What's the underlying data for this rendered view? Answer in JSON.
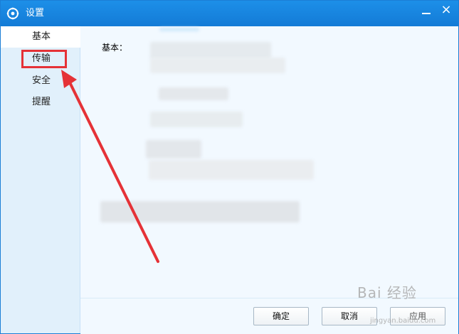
{
  "window": {
    "title": "设置",
    "icon": "gear-icon",
    "minimize_icon": "minimize-icon",
    "close_icon": "close-icon",
    "close_glyph": "×"
  },
  "sidebar": {
    "items": [
      {
        "label": "基本",
        "state": "active"
      },
      {
        "label": "传输",
        "state": "highlighted"
      },
      {
        "label": "安全",
        "state": ""
      },
      {
        "label": "提醒",
        "state": ""
      }
    ]
  },
  "content": {
    "section_label": "基本："
  },
  "footer": {
    "ok_label": "确定",
    "cancel_label": "取消",
    "apply_label": "应用"
  },
  "watermark": {
    "main": "Bai 经验",
    "sub": "jingyan.baidu.com"
  },
  "colors": {
    "title_bar": "#1886e0",
    "sidebar_bg": "#e1f0fb",
    "content_bg": "#f2f9ff",
    "annotation_red": "#e53237"
  }
}
